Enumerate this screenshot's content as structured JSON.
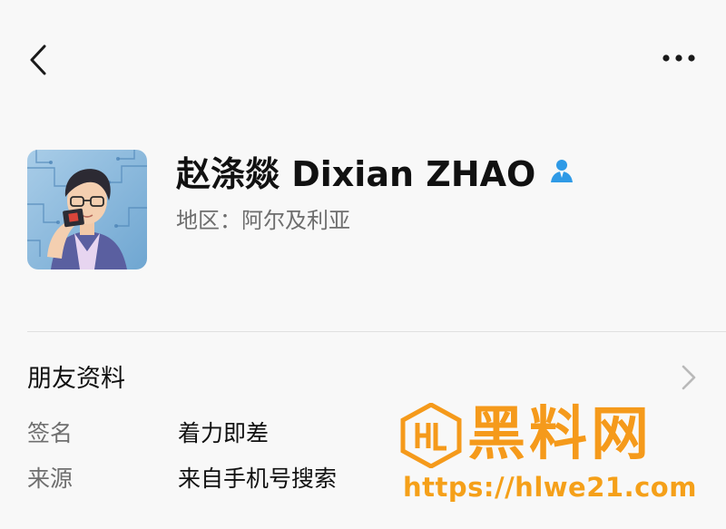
{
  "header": {
    "back_icon": "chevron-left-icon",
    "more_icon": "more-horizontal-icon"
  },
  "profile": {
    "name": "赵涤燚 Dixian ZHAO",
    "badge_icon": "person-verified-icon",
    "region": "地区：阿尔及利亚",
    "avatar_icon": "avatar-illustration"
  },
  "section": {
    "title": "朋友资料",
    "chevron_icon": "chevron-right-icon"
  },
  "info": [
    {
      "label": "签名",
      "value": "着力即差"
    },
    {
      "label": "来源",
      "value": "来自手机号搜索"
    }
  ],
  "watermark": {
    "brand": "黑料网",
    "url": "https://hlwe21.com"
  },
  "colors": {
    "accent_blue": "#2f9ae6",
    "watermark_orange": "#f59a1b"
  }
}
